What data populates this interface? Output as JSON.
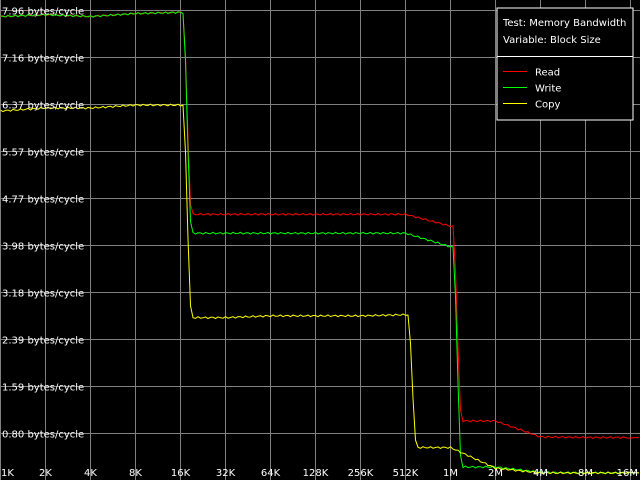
{
  "chart_data": {
    "type": "line",
    "info": {
      "test": "Test: Memory Bandwidth",
      "variable": "Variable: Block Size"
    },
    "x": [
      "1K",
      "2K",
      "4K",
      "8K",
      "16K",
      "32K",
      "64K",
      "128K",
      "256K",
      "512K",
      "1M",
      "2M",
      "4M",
      "8M",
      "16M"
    ],
    "x_scale": "log2",
    "y_ticks": [
      "0.80 bytes/cycle",
      "1.59 bytes/cycle",
      "2.39 bytes/cycle",
      "3.18 bytes/cycle",
      "3.98 bytes/cycle",
      "4.77 bytes/cycle",
      "5.57 bytes/cycle",
      "6.37 bytes/cycle",
      "7.16 bytes/cycle",
      "7.96 bytes/cycle"
    ],
    "ylim": [
      0,
      7.96
    ],
    "grid": true,
    "legend_position": "top-right",
    "series": [
      {
        "name": "Read",
        "color": "#ff0000",
        "values": [
          7.85,
          7.88,
          7.85,
          7.9,
          7.92,
          4.5,
          4.5,
          4.5,
          4.5,
          4.5,
          4.3,
          1.0,
          0.73,
          0.72,
          0.72
        ]
      },
      {
        "name": "Write",
        "color": "#00ff00",
        "values": [
          7.85,
          7.88,
          7.85,
          7.9,
          7.92,
          4.18,
          4.18,
          4.18,
          4.18,
          4.18,
          3.95,
          0.22,
          0.13,
          0.12,
          0.12
        ]
      },
      {
        "name": "Copy",
        "color": "#ffff00",
        "values": [
          6.25,
          6.3,
          6.3,
          6.35,
          6.35,
          2.75,
          2.78,
          2.78,
          2.78,
          2.8,
          0.55,
          0.2,
          0.12,
          0.12,
          0.12
        ]
      }
    ]
  }
}
